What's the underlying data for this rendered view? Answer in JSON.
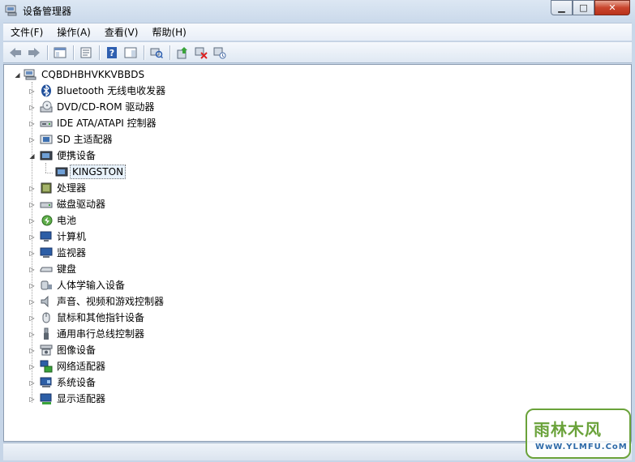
{
  "window": {
    "title": "设备管理器",
    "minimize_label": "▁",
    "maximize_label": "□",
    "close_label": "✕"
  },
  "menu": {
    "items": [
      {
        "label": "文件(F)"
      },
      {
        "label": "操作(A)"
      },
      {
        "label": "查看(V)"
      },
      {
        "label": "帮助(H)"
      }
    ]
  },
  "toolbar": {
    "buttons": [
      "back-icon",
      "forward-icon",
      "show-hide-console-tree-icon",
      "properties-icon",
      "help-icon",
      "action-pane-icon",
      "scan-hardware-icon",
      "update-driver-icon",
      "uninstall-icon",
      "disable-icon"
    ]
  },
  "tree": {
    "root": "CQBDHBHVKKVBBDS",
    "items": [
      {
        "label": "Bluetooth 无线电收发器",
        "icon": "bluetooth-icon",
        "expanded": false
      },
      {
        "label": "DVD/CD-ROM 驱动器",
        "icon": "dvd-drive-icon",
        "expanded": false
      },
      {
        "label": "IDE ATA/ATAPI 控制器",
        "icon": "ide-controller-icon",
        "expanded": false
      },
      {
        "label": "SD 主适配器",
        "icon": "sd-adapter-icon",
        "expanded": false
      },
      {
        "label": "便携设备",
        "icon": "portable-device-icon",
        "expanded": true
      },
      {
        "label": "处理器",
        "icon": "processor-icon",
        "expanded": false
      },
      {
        "label": "磁盘驱动器",
        "icon": "disk-drive-icon",
        "expanded": false
      },
      {
        "label": "电池",
        "icon": "battery-icon",
        "expanded": false
      },
      {
        "label": "计算机",
        "icon": "computer-icon",
        "expanded": false
      },
      {
        "label": "监视器",
        "icon": "monitor-icon",
        "expanded": false
      },
      {
        "label": "键盘",
        "icon": "keyboard-icon",
        "expanded": false
      },
      {
        "label": "人体学输入设备",
        "icon": "hid-icon",
        "expanded": false
      },
      {
        "label": "声音、视频和游戏控制器",
        "icon": "sound-icon",
        "expanded": false
      },
      {
        "label": "鼠标和其他指针设备",
        "icon": "mouse-icon",
        "expanded": false
      },
      {
        "label": "通用串行总线控制器",
        "icon": "usb-icon",
        "expanded": false
      },
      {
        "label": "图像设备",
        "icon": "imaging-icon",
        "expanded": false
      },
      {
        "label": "网络适配器",
        "icon": "network-adapter-icon",
        "expanded": false
      },
      {
        "label": "系统设备",
        "icon": "system-device-icon",
        "expanded": false
      },
      {
        "label": "显示适配器",
        "icon": "display-adapter-icon",
        "expanded": false
      }
    ],
    "child_of_portable": "KINGSTON"
  },
  "watermark": {
    "title": "雨林木风",
    "url": "WwW.YLMFU.CoM"
  }
}
